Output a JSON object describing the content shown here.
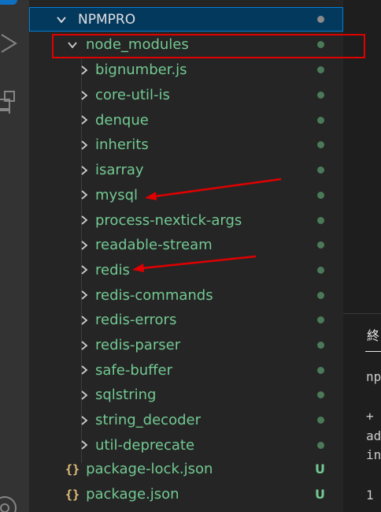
{
  "explorer": {
    "root": {
      "label": "NPMPRO"
    },
    "node_modules": {
      "label": "node_modules"
    },
    "packages": [
      {
        "label": "bignumber.js"
      },
      {
        "label": "core-util-is"
      },
      {
        "label": "denque"
      },
      {
        "label": "inherits"
      },
      {
        "label": "isarray"
      },
      {
        "label": "mysql"
      },
      {
        "label": "process-nextick-args"
      },
      {
        "label": "readable-stream"
      },
      {
        "label": "redis"
      },
      {
        "label": "redis-commands"
      },
      {
        "label": "redis-errors"
      },
      {
        "label": "redis-parser"
      },
      {
        "label": "safe-buffer"
      },
      {
        "label": "sqlstring"
      },
      {
        "label": "string_decoder"
      },
      {
        "label": "util-deprecate"
      }
    ],
    "files": [
      {
        "label": "package-lock.json",
        "status": "U",
        "icon": "{}"
      },
      {
        "label": "package.json",
        "status": "U",
        "icon": "{}"
      }
    ]
  },
  "terminal": {
    "tab_label": "終",
    "lines": [
      "np",
      "+",
      "ad",
      "in",
      "1"
    ]
  },
  "colors": {
    "untracked_green": "#73c991",
    "annotation_red": "#e00000",
    "selection_blue": "#04395e"
  }
}
